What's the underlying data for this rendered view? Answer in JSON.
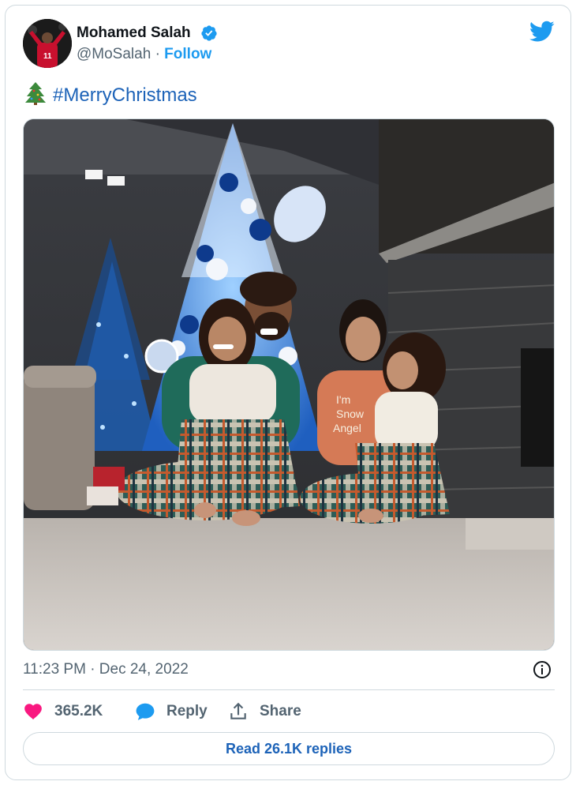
{
  "tweet": {
    "author_name": "Mohamed Salah",
    "handle": "@MoSalah",
    "separator": "·",
    "follow_label": "Follow",
    "text_hashtag": "#MerryChristmas",
    "timestamp": "11:23 PM · Dec 24, 2022",
    "likes": "365.2K",
    "reply_label": "Reply",
    "share_label": "Share",
    "read_replies_label": "Read 26.1K replies"
  },
  "icons": {
    "verified": "verified-badge-icon",
    "twitter": "twitter-bird-icon",
    "tree": "christmas-tree-emoji",
    "info": "info-icon",
    "like": "heart-icon",
    "reply": "speech-bubble-icon",
    "share": "share-upload-icon"
  },
  "colors": {
    "accent": "#1d9bf0",
    "link": "#1d63b8",
    "like": "#f91880",
    "muted": "#536471",
    "border": "#cfd9de"
  }
}
